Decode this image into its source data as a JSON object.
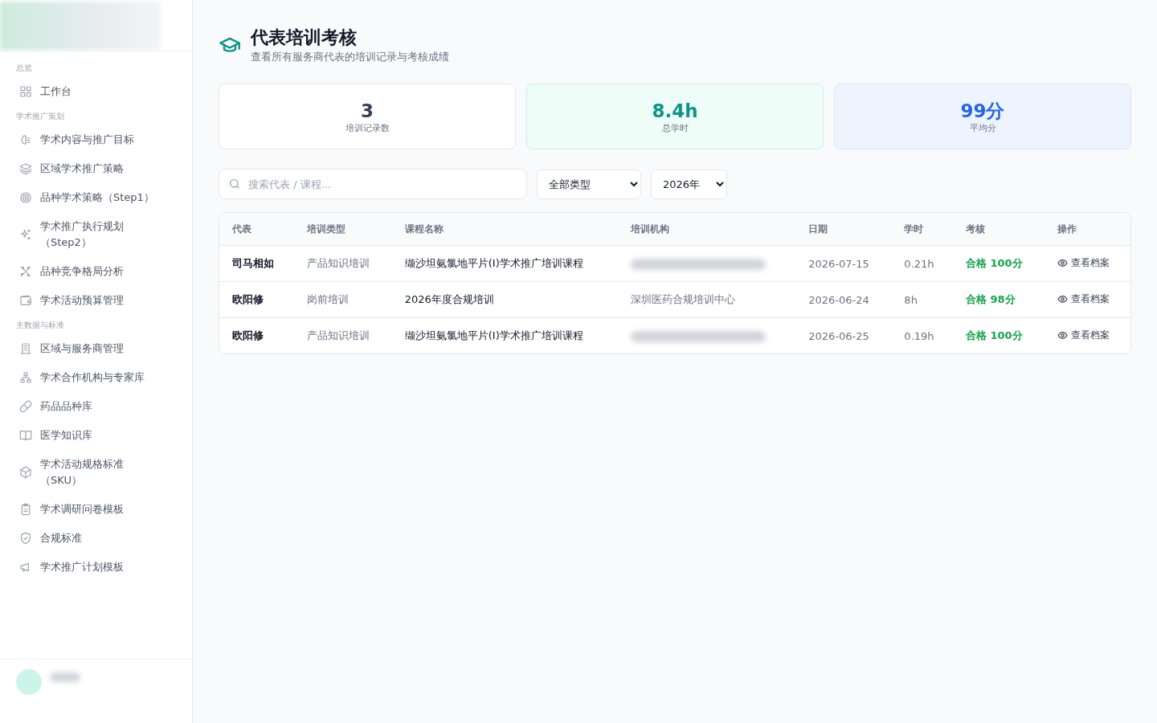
{
  "sidebar": {
    "sections": [
      {
        "title": "总览",
        "items": [
          {
            "label": "工作台"
          }
        ]
      },
      {
        "title": "学术推广策划",
        "items": [
          {
            "label": "学术内容与推广目标"
          },
          {
            "label": "区域学术推广策略"
          },
          {
            "label": "品种学术策略（Step1）"
          },
          {
            "label": "学术推广执行规划（Step2）"
          },
          {
            "label": "品种竞争格局分析"
          },
          {
            "label": "学术活动预算管理"
          }
        ]
      },
      {
        "title": "主数据与标准",
        "items": [
          {
            "label": "区域与服务商管理"
          },
          {
            "label": "学术合作机构与专家库"
          },
          {
            "label": "药品品种库"
          },
          {
            "label": "医学知识库"
          },
          {
            "label": "学术活动规格标准（SKU）"
          },
          {
            "label": "学术调研问卷模板"
          },
          {
            "label": "合规标准"
          },
          {
            "label": "学术推广计划模板"
          }
        ]
      }
    ]
  },
  "header": {
    "title": "代表培训考核",
    "subtitle": "查看所有服务商代表的培训记录与考核成绩"
  },
  "stats": [
    {
      "kind": "neutral",
      "value": "3",
      "label": "培训记录数"
    },
    {
      "kind": "teal",
      "value": "8.4h",
      "label": "总学时"
    },
    {
      "kind": "blue",
      "value": "99分",
      "label": "平均分"
    }
  ],
  "filters": {
    "search": {
      "placeholder": "搜索代表 / 课程..."
    },
    "type_select": {
      "value": "全部类型"
    },
    "year_select": {
      "value": "2026年"
    }
  },
  "table": {
    "columns": [
      "代表",
      "培训类型",
      "课程名称",
      "培训机构",
      "日期",
      "学时",
      "考核",
      "操作"
    ],
    "rows": [
      {
        "rep": "司马相如",
        "type": "产品知识培训",
        "course": "缬沙坦氨氯地平片(Ⅰ)学术推广培训课程",
        "institution": null,
        "date": "2026-07-15",
        "hours": "0.21h",
        "result": "合格 100分",
        "passed": true,
        "action": "查看档案"
      },
      {
        "rep": "欧阳修",
        "type": "岗前培训",
        "course": "2026年度合规培训",
        "institution": "深圳医药合规培训中心",
        "date": "2026-06-24",
        "hours": "8h",
        "result": "合格 98分",
        "passed": true,
        "action": "查看档案"
      },
      {
        "rep": "欧阳修",
        "type": "产品知识培训",
        "course": "缬沙坦氨氯地平片(Ⅰ)学术推广培训课程",
        "institution": null,
        "date": "2026-06-25",
        "hours": "0.19h",
        "result": "合格 100分",
        "passed": true,
        "action": "查看档案"
      }
    ]
  }
}
